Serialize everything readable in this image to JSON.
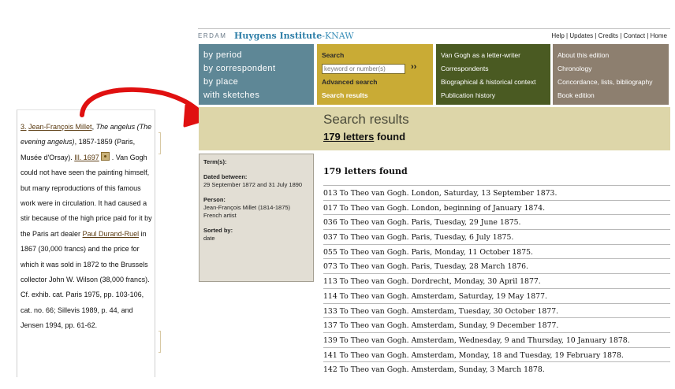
{
  "header": {
    "brand_prefix": "ERDAM",
    "brand_name": "Huygens Institute",
    "brand_suffix": "-KNAW",
    "links": [
      "Help",
      "Updates",
      "Credits",
      "Contact",
      "Home"
    ]
  },
  "menu": {
    "browse": [
      "by period",
      "by correspondent",
      "by place",
      "with sketches"
    ],
    "search": {
      "label": "Search",
      "placeholder": "keyword or number(s)",
      "go": "››",
      "advanced": "Advanced search",
      "results": "Search results"
    },
    "about": [
      "Van Gogh as a letter-writer",
      "Correspondents",
      "Biographical & historical context",
      "Publication history"
    ],
    "edition": [
      "About this edition",
      "Chronology",
      "Concordance, lists, bibliography",
      "Book edition"
    ]
  },
  "results": {
    "title": "Search results",
    "count_link": "179 letters",
    "count_suffix": " found",
    "list_heading": "179 letters found",
    "items": [
      "013 To Theo van Gogh. London, Saturday, 13 September 1873.",
      "017 To Theo van Gogh. London, beginning of January 1874.",
      "036 To Theo van Gogh. Paris, Tuesday, 29 June 1875.",
      "037 To Theo van Gogh. Paris, Tuesday, 6 July 1875.",
      "055 To Theo van Gogh. Paris, Monday, 11 October 1875.",
      "073 To Theo van Gogh. Paris, Tuesday, 28 March 1876.",
      "113 To Theo van Gogh. Dordrecht, Monday, 30 April 1877.",
      "114 To Theo van Gogh. Amsterdam, Saturday, 19 May 1877.",
      "133 To Theo van Gogh. Amsterdam, Tuesday, 30 October 1877.",
      "137 To Theo van Gogh. Amsterdam, Sunday, 9 December 1877.",
      "139 To Theo van Gogh. Amsterdam, Wednesday, 9 and Thursday, 10 January 1878.",
      "141 To Theo van Gogh. Amsterdam, Monday, 18 and Tuesday, 19 February 1878.",
      "142 To Theo van Gogh. Amsterdam, Sunday, 3 March 1878."
    ]
  },
  "terms": {
    "label": "Term(s):",
    "dated_label": "Dated between:",
    "dated_value": "29 September 1872 and 31 July 1890",
    "person_label": "Person:",
    "person_value": "Jean-François Millet (1814-1875) French artist",
    "sorted_label": "Sorted by:",
    "sorted_value": "date"
  },
  "footnote": {
    "num": "3.",
    "artist": "Jean-François Millet",
    "sep": ", ",
    "title": "The angelus (The evening angelus)",
    "text1": ", 1857-1859 (Paris, Musée d'Orsay). ",
    "ill": "Ill. 1697",
    "text2": " . Van Gogh could not have seen the painting himself, but many reproductions of this famous work were in circulation. It had caused a stir because of the high price paid for it by the Paris art dealer ",
    "dealer": "Paul Durand-Ruel",
    "text3": " in 1867 (30,000 francs) and the price for which it was sold in 1872 to the Brussels collector John W. Wilson (38,000 francs). Cf. exhib. cat. Paris 1975, pp. 103-106, cat. no. 66; Sillevis 1989, p. 44, and Jensen 1994, pp. 61-62."
  },
  "colors": {
    "browse": "#5e8796",
    "search": "#c9ab35",
    "about": "#4a5a22",
    "edition": "#8d7f6f",
    "results_bar": "#ddd6a9",
    "arrow": "#e01010"
  }
}
